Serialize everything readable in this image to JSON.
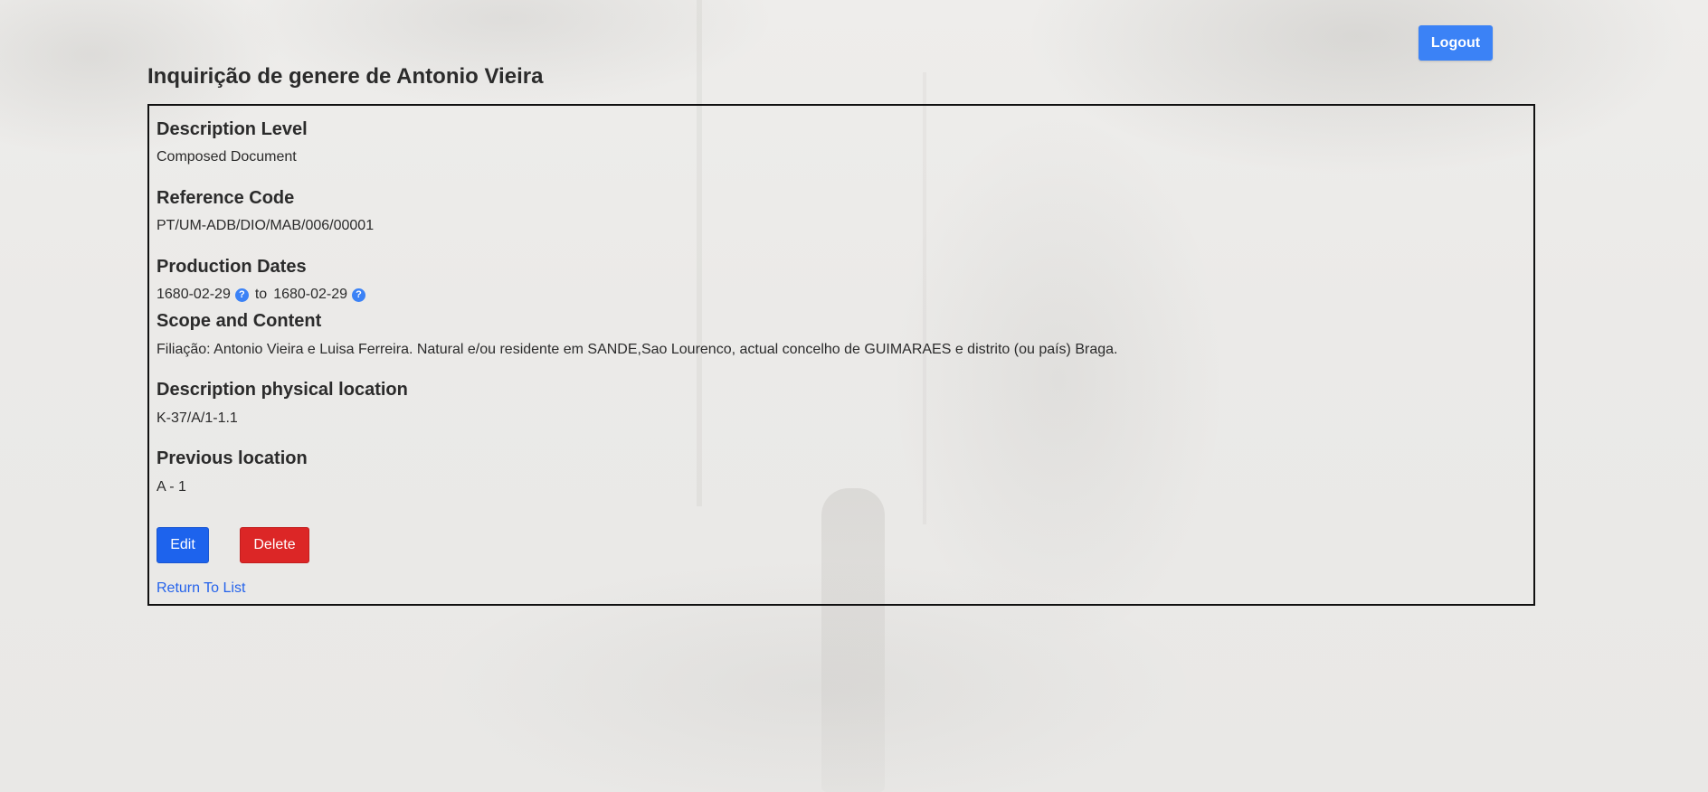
{
  "header": {
    "logout_label": "Logout",
    "title": "Inquirição de genere de Antonio Vieira"
  },
  "record": {
    "description_level": {
      "heading": "Description Level",
      "value": "Composed Document"
    },
    "reference_code": {
      "heading": "Reference Code",
      "value": "PT/UM-ADB/DIO/MAB/006/00001"
    },
    "production_dates": {
      "heading": "Production Dates",
      "start": "1680-02-29",
      "separator": "to",
      "end": "1680-02-29",
      "help_glyph": "?"
    },
    "scope_and_content": {
      "heading": "Scope and Content",
      "value": "Filiação: Antonio Vieira e Luisa Ferreira. Natural e/ou residente em SANDE,Sao Lourenco, actual concelho de GUIMARAES e distrito (ou país) Braga."
    },
    "physical_location": {
      "heading": "Description physical location",
      "value": "K-37/A/1-1.1"
    },
    "previous_location": {
      "heading": "Previous location",
      "value": "A - 1"
    }
  },
  "actions": {
    "edit_label": "Edit",
    "delete_label": "Delete",
    "return_label": "Return To List"
  },
  "colors": {
    "primary": "#3b82f6",
    "edit": "#1d63ed",
    "delete": "#dc2626",
    "link": "#2563eb"
  }
}
